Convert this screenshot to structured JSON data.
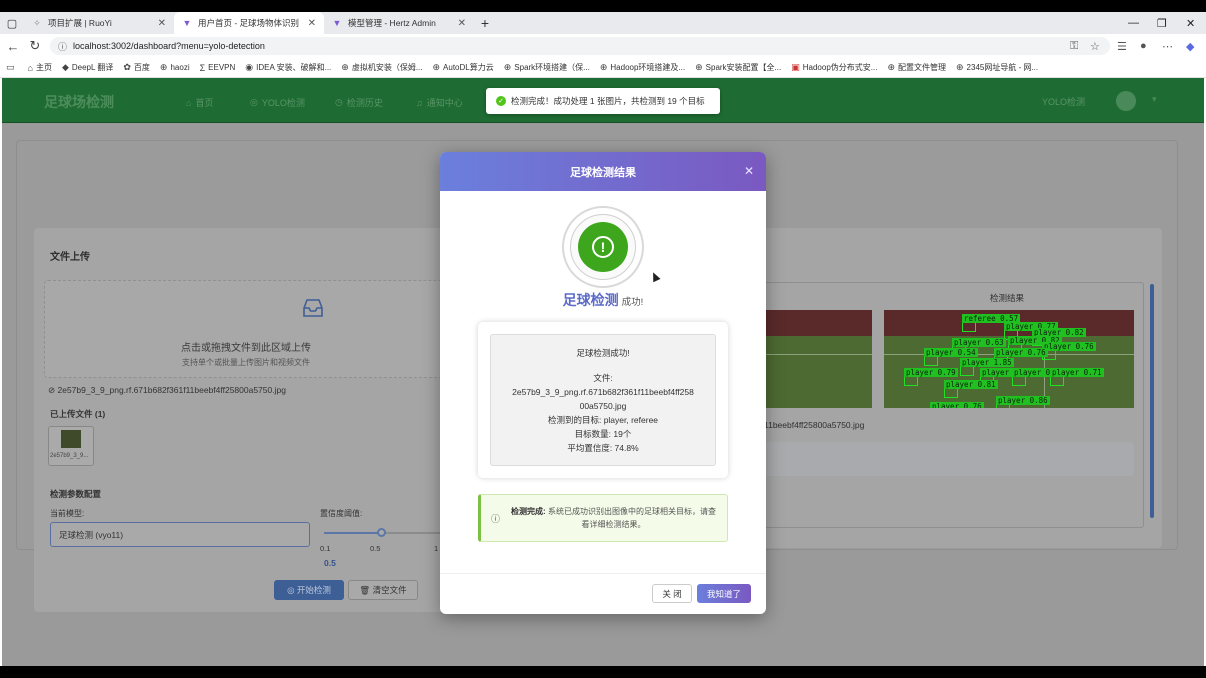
{
  "browser": {
    "tabs": [
      {
        "title": "项目扩展 | RuoYi"
      },
      {
        "title": "用户首页 - 足球场物体识别"
      },
      {
        "title": "模型管理 - Hertz Admin"
      }
    ],
    "url": "localhost:3002/dashboard?menu=yolo-detection",
    "bookmarks": [
      "主页",
      "DeepL 翻译",
      "百度",
      "haozi",
      "EEVPN",
      "IDEA 安装、破解和...",
      "虚拟机安装（保姆...",
      "AutoDL算力云",
      "Spark环境搭建（保...",
      "Hadoop环境搭建及...",
      "Spark安装配置【全...",
      "Hadoop伪分布式安...",
      "配置文件管理",
      "2345网址导航 - 网..."
    ]
  },
  "app": {
    "brand": "足球场检测",
    "nav": [
      {
        "label": "首页"
      },
      {
        "label": "YOLO检测"
      },
      {
        "label": "检测历史"
      },
      {
        "label": "通知中心"
      }
    ],
    "right_label": "YOLO检测"
  },
  "toast": {
    "text": "检测完成！成功处理 1 张图片，共检测到 19 个目标"
  },
  "upload": {
    "title": "文件上传",
    "drop_main": "点击或拖拽文件到此区域上传",
    "drop_sub": "支持单个或批量上传图片和视频文件",
    "file_name": "2e57b9_3_9_png.rf.671b682f361f11beebf4ff25800a5750.jpg",
    "uploaded_label": "已上传文件 (1)",
    "thumb_caption": "2e57b9_3_9..."
  },
  "params": {
    "title": "检测参数配置",
    "model_label": "当前模型:",
    "model_value": "足球检测 (vyo11)",
    "conf_label": "置信度阈值:",
    "conf_ticks": [
      "0.1",
      "0.5",
      "1"
    ],
    "conf_value": "0.5",
    "conf_fraction": 0.44,
    "start_button": "开始检测",
    "clear_button": "清空文件"
  },
  "result_panel": {
    "label": "检测结果",
    "file_suffix": "11beebf4ff25800a5750.jpg",
    "detections": [
      {
        "label": "referee 0.57"
      },
      {
        "label": "player 0.77"
      },
      {
        "label": "player 0.82"
      },
      {
        "label": "player 0.63"
      },
      {
        "label": "player 0.82"
      },
      {
        "label": "player 0.76"
      },
      {
        "label": "player 0.54"
      },
      {
        "label": "player 0.76"
      },
      {
        "label": "player 1.85"
      },
      {
        "label": "player 0.79"
      },
      {
        "label": "player 0.62"
      },
      {
        "label": "player 0.84"
      },
      {
        "label": "player 0.71"
      },
      {
        "label": "player 0.81"
      },
      {
        "label": "player 0.86"
      },
      {
        "label": "player 0.76"
      }
    ]
  },
  "modal": {
    "title": "足球检测结果",
    "status_big": "足球检测",
    "status_small": "成功!",
    "info_heading": "足球检测成功!",
    "file_label": "文件:",
    "file_line1": "2e57b9_3_9_png.rf.671b682f361f11beebf4ff258",
    "file_line2": "00a5750.jpg",
    "targets": "检测到的目标: player, referee",
    "count": "目标数量: 19个",
    "avg_conf": "平均置信度: 74.8%",
    "notice_bold": "检测完成:",
    "notice_text": "系统已成功识别出图像中的足球相关目标，请查看详细检测结果。",
    "close_button": "关 闭",
    "ok_button": "我知道了"
  }
}
